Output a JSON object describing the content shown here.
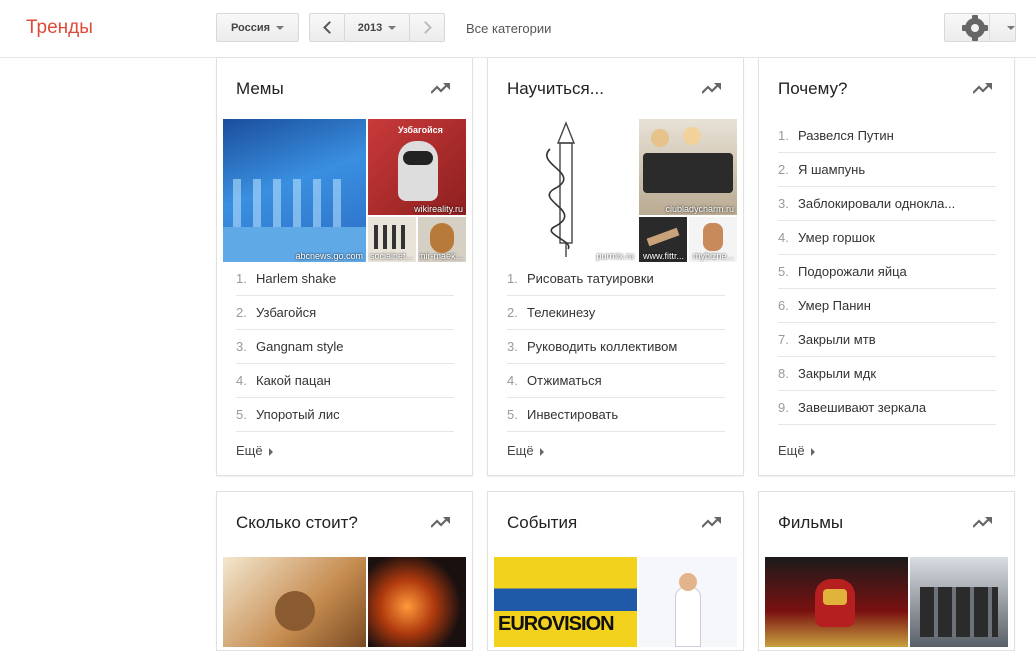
{
  "header": {
    "logo": "Тренды",
    "country": "Россия",
    "year": "2013",
    "categories": "Все категории"
  },
  "cards": [
    {
      "title": "Мемы",
      "image_sources": [
        "abcnews.go.com",
        "wikireality.ru",
        "socialnet...",
        "mir-maek..."
      ],
      "image_caption": "Узбагойся",
      "items": [
        "Harlem shake",
        "Узбагойся",
        "Gangnam style",
        "Какой пацан",
        "Упоротый лис"
      ],
      "more": "Ещё"
    },
    {
      "title": "Научиться...",
      "image_sources": [
        "purmix.ru",
        "clubladycharm.ru",
        "www.fittr...",
        "mybizne..."
      ],
      "items": [
        "Рисовать татуировки",
        "Телекинезу",
        "Руководить коллективом",
        "Отжиматься",
        "Инвестировать"
      ],
      "more": "Ещё"
    },
    {
      "title": "Почему?",
      "items": [
        "Развелся Путин",
        "Я шампунь",
        "Заблокировали однокла...",
        "Умер горшок",
        "Подорожали яйца",
        "Умер Панин",
        "Закрыли мтв",
        "Закрыли мдк",
        "Завешивают зеркала"
      ],
      "more": "Ещё"
    },
    {
      "title": "Сколько стоит?"
    },
    {
      "title": "События",
      "image_caption": "EUROVISION"
    },
    {
      "title": "Фильмы"
    }
  ],
  "colors": {
    "brand": "#dd4b39",
    "accent": "#4a7fb5"
  }
}
